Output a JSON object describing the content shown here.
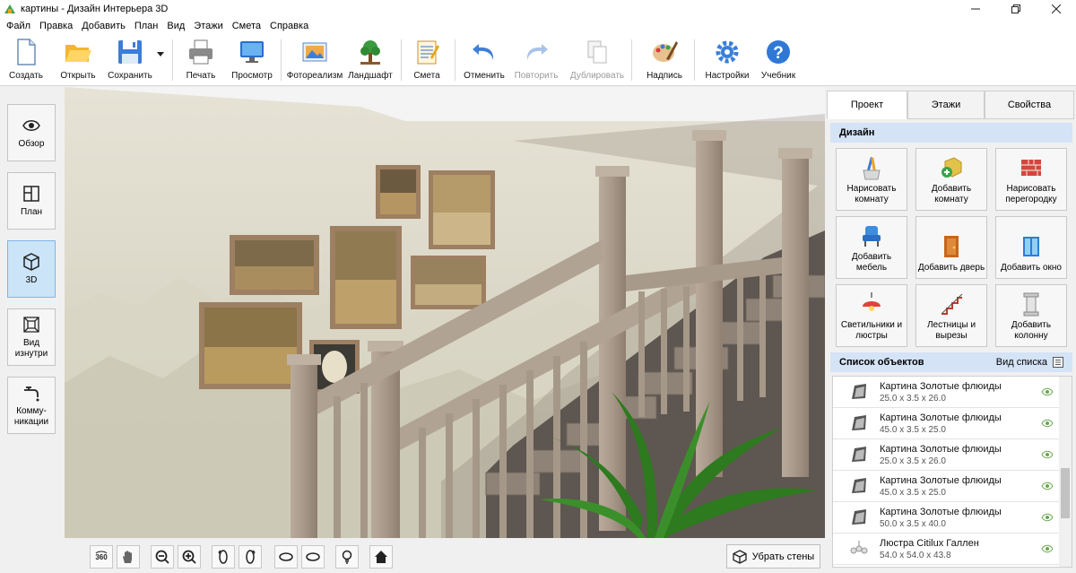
{
  "window": {
    "title": "картины - Дизайн Интерьера 3D"
  },
  "menu": [
    "Файл",
    "Правка",
    "Добавить",
    "План",
    "Вид",
    "Этажи",
    "Смета",
    "Справка"
  ],
  "toolbar": {
    "create": "Создать",
    "open": "Открыть",
    "save": "Сохранить",
    "print": "Печать",
    "preview": "Просмотр",
    "photoreal": "Фотореализм",
    "landscape": "Ландшафт",
    "estimate": "Смета",
    "undo": "Отменить",
    "redo": "Повторить",
    "duplicate": "Дублировать",
    "caption": "Надпись",
    "settings": "Настройки",
    "tutorial": "Учебник"
  },
  "left_panel": {
    "overview": "Обзор",
    "plan": "План",
    "view3d": "3D",
    "inside": "Вид изнутри",
    "utilities": "Комму-никации"
  },
  "viewport_tools": {
    "remove_walls": "Убрать стены"
  },
  "right_panel": {
    "tabs": [
      "Проект",
      "Этажи",
      "Свойства"
    ],
    "design_title": "Дизайн",
    "design_buttons": [
      {
        "label": "Нарисовать комнату",
        "icon": "draw-room-icon"
      },
      {
        "label": "Добавить комнату",
        "icon": "add-room-icon"
      },
      {
        "label": "Нарисовать перегородку",
        "icon": "brick-wall-icon"
      },
      {
        "label": "Добавить мебель",
        "icon": "armchair-icon"
      },
      {
        "label": "Добавить дверь",
        "icon": "door-icon"
      },
      {
        "label": "Добавить окно",
        "icon": "window-icon"
      },
      {
        "label": "Светильники и люстры",
        "icon": "lamp-icon"
      },
      {
        "label": "Лестницы и вырезы",
        "icon": "stairs-icon"
      },
      {
        "label": "Добавить колонну",
        "icon": "column-icon"
      }
    ],
    "objects_title": "Список объектов",
    "view_list": "Вид списка",
    "objects": [
      {
        "name": "Картина Золотые флюиды",
        "dims": "25.0 x 3.5 x 26.0"
      },
      {
        "name": "Картина Золотые флюиды",
        "dims": "45.0 x 3.5 x 25.0"
      },
      {
        "name": "Картина Золотые флюиды",
        "dims": "25.0 x 3.5 x 26.0"
      },
      {
        "name": "Картина Золотые флюиды",
        "dims": "45.0 x 3.5 x 25.0"
      },
      {
        "name": "Картина Золотые флюиды",
        "dims": "50.0 x 3.5 x 40.0"
      },
      {
        "name": "Люстра Citilux Галлен",
        "dims": "54.0 x 54.0 x 43.8"
      }
    ]
  },
  "colors": {
    "accent": "#1e78d7",
    "section_bg": "#d4e3f6",
    "active_tab": "#cce4f7"
  }
}
